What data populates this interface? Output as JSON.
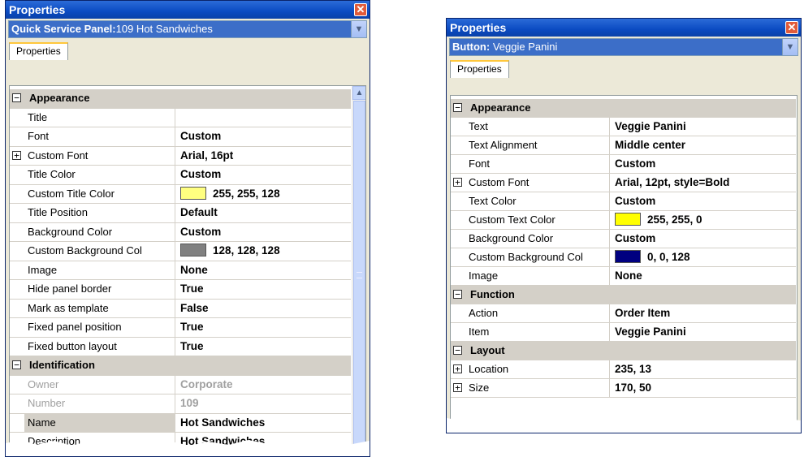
{
  "left": {
    "title": "Properties",
    "selector": {
      "type": "Quick Service Panel:",
      "name": "109 Hot Sandwiches"
    },
    "tab": "Properties",
    "rows": [
      {
        "kind": "cat",
        "label": "Appearance",
        "expander": "⊟"
      },
      {
        "name": "Title",
        "value": ""
      },
      {
        "name": "Font",
        "value": "Custom"
      },
      {
        "name": "Custom Font",
        "value": "Arial, 16pt",
        "expander": "+"
      },
      {
        "name": "Title Color",
        "value": "Custom"
      },
      {
        "name": "Custom Title Color",
        "value": "255, 255, 128",
        "swatch": "#ffff80"
      },
      {
        "name": "Title Position",
        "value": "Default"
      },
      {
        "name": "Background Color",
        "value": "Custom"
      },
      {
        "name": "Custom Background Col",
        "value": "128, 128, 128",
        "swatch": "#808080"
      },
      {
        "name": "Image",
        "value": "None"
      },
      {
        "name": "Hide panel border",
        "value": "True"
      },
      {
        "name": "Mark as template",
        "value": "False"
      },
      {
        "name": "Fixed panel position",
        "value": "True"
      },
      {
        "name": "Fixed button layout",
        "value": "True"
      },
      {
        "kind": "cat",
        "label": "Identification",
        "expander": "⊟"
      },
      {
        "name": "Owner",
        "value": "Corporate",
        "dim": true
      },
      {
        "name": "Number",
        "value": "109",
        "dim": true
      },
      {
        "name": "Name",
        "value": "Hot Sandwiches",
        "sel": true
      },
      {
        "name": "Description",
        "value": "Hot Sandwiches"
      }
    ]
  },
  "right": {
    "title": "Properties",
    "selector": {
      "type": "Button:",
      "name": "Veggie Panini"
    },
    "tab": "Properties",
    "rows": [
      {
        "kind": "cat",
        "label": "Appearance",
        "expander": "⊟"
      },
      {
        "name": "Text",
        "value": "Veggie Panini"
      },
      {
        "name": "Text Alignment",
        "value": "Middle center"
      },
      {
        "name": "Font",
        "value": "Custom"
      },
      {
        "name": "Custom Font",
        "value": "Arial, 12pt, style=Bold",
        "expander": "+"
      },
      {
        "name": "Text Color",
        "value": "Custom"
      },
      {
        "name": "Custom Text Color",
        "value": "255, 255, 0",
        "swatch": "#ffff00"
      },
      {
        "name": "Background Color",
        "value": "Custom"
      },
      {
        "name": "Custom Background Col",
        "value": "0, 0, 128",
        "swatch": "#000080"
      },
      {
        "name": "Image",
        "value": "None"
      },
      {
        "kind": "cat",
        "label": "Function",
        "expander": "⊟"
      },
      {
        "name": "Action",
        "value": "Order Item"
      },
      {
        "name": "Item",
        "value": "Veggie Panini"
      },
      {
        "kind": "cat",
        "label": "Layout",
        "expander": "⊟"
      },
      {
        "name": "Location",
        "value": "235, 13",
        "expander": "+"
      },
      {
        "name": "Size",
        "value": "170, 50",
        "expander": "+"
      }
    ]
  },
  "icons": {
    "close": "close-icon",
    "dropdown": "chevron-down-icon",
    "scroll_up": "scroll-up-arrow-icon"
  }
}
